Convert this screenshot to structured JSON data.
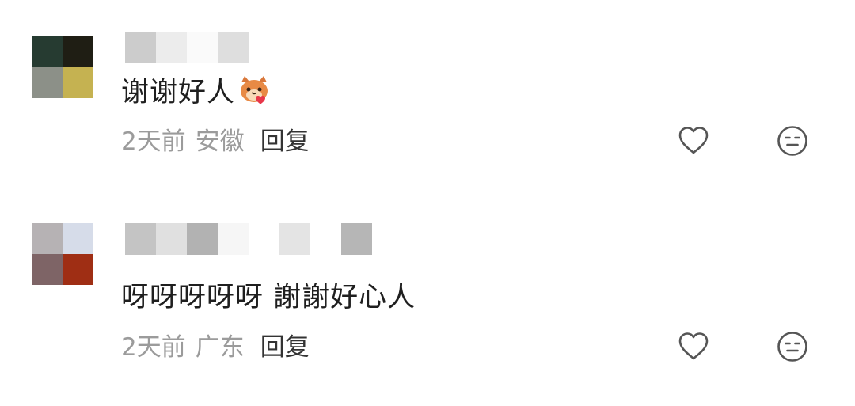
{
  "comments": [
    {
      "avatar_colors": [
        "#263b31",
        "#1f1e14",
        "#8c9088",
        "#c5b251"
      ],
      "name_mosaic_colors": [
        "#cccccc",
        "#ececec",
        "#fafafa",
        "#dedede"
      ],
      "text": "谢谢好人",
      "sticker_icon": "cat-heart-sticker",
      "time": "2天前",
      "location": "安徽",
      "reply_label": "回复"
    },
    {
      "avatar_colors": [
        "#b6b2b4",
        "#d6dce9",
        "#7e6466",
        "#9f2e14"
      ],
      "name_mosaic_colors": [
        "#c4c4c4",
        "#e0e0e0",
        "#b2b2b2",
        "#f6f6f6",
        "#ffffff",
        "#e4e4e4",
        "#ffffff",
        "#b6b6b6"
      ],
      "text": "呀呀呀呀呀 謝謝好心人",
      "time": "2天前",
      "location": "广东",
      "reply_label": "回复"
    }
  ],
  "icons": {
    "like": "heart-icon",
    "dislike": "neutral-face-icon"
  },
  "colors": {
    "text": "#1f1f1f",
    "meta": "#9b9b9b",
    "reply": "#333333",
    "icon": "#555555"
  }
}
